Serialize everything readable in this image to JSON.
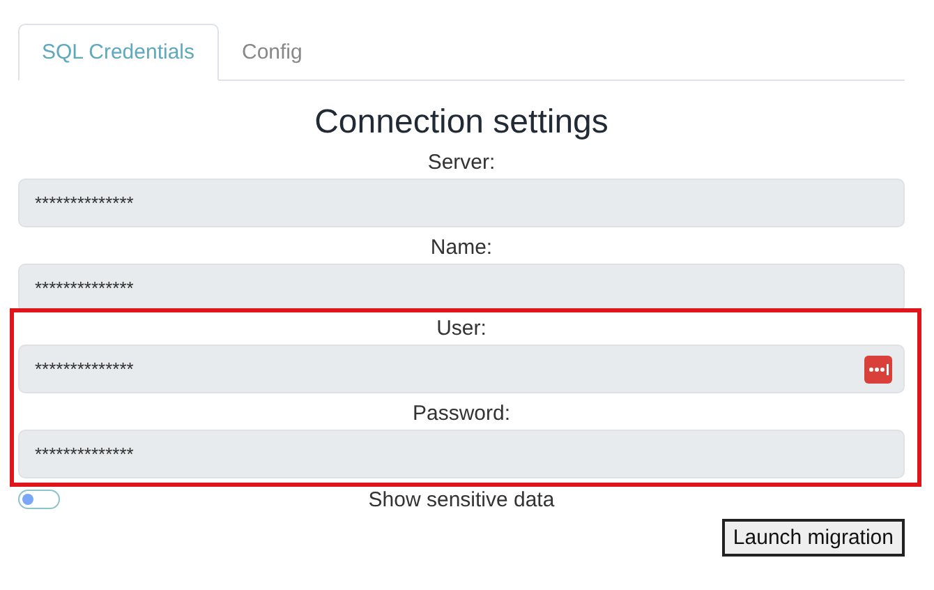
{
  "tabs": [
    {
      "label": "SQL Credentials",
      "selected": true
    },
    {
      "label": "Config",
      "selected": false
    }
  ],
  "heading": "Connection settings",
  "fields": [
    {
      "label": "Server:",
      "value": "**************",
      "highlighted": false,
      "autofill_icon": false
    },
    {
      "label": "Name:",
      "value": "**************",
      "highlighted": false,
      "autofill_icon": false
    },
    {
      "label": "User:",
      "value": "**************",
      "highlighted": true,
      "autofill_icon": true
    },
    {
      "label": "Password:",
      "value": "**************",
      "highlighted": true,
      "autofill_icon": false
    }
  ],
  "toggle": {
    "label": "Show sensitive data",
    "on": false
  },
  "button": "Launch migration"
}
